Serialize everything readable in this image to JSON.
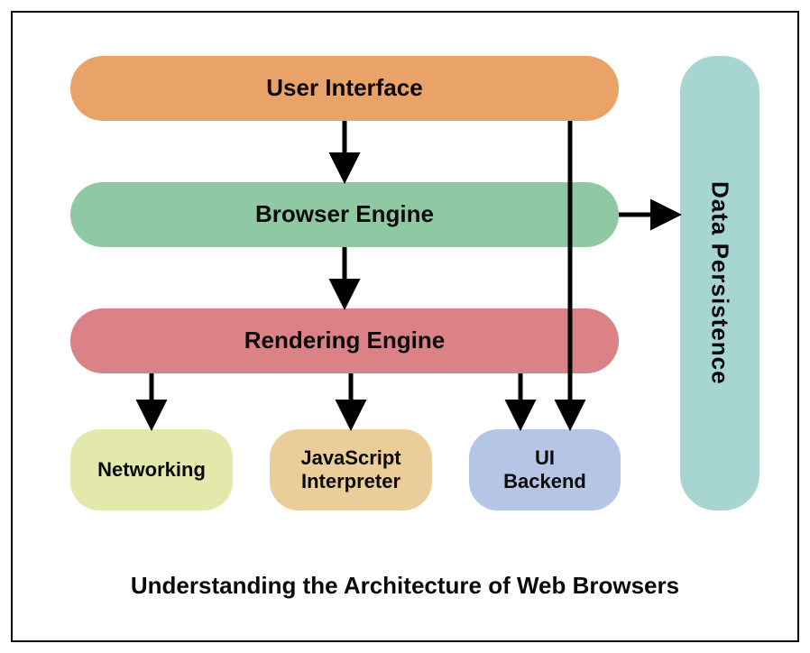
{
  "diagram": {
    "title": "Understanding the Architecture of Web Browsers",
    "boxes": {
      "user_interface": {
        "label": "User Interface",
        "color": "#e9a268"
      },
      "browser_engine": {
        "label": "Browser Engine",
        "color": "#8fc9a3"
      },
      "rendering_engine": {
        "label": "Rendering Engine",
        "color": "#da8286"
      },
      "networking": {
        "label": "Networking",
        "color": "#e2e9ab"
      },
      "js_interpreter": {
        "label": "JavaScript\nInterpreter",
        "color": "#ebcd99"
      },
      "ui_backend": {
        "label": "UI\nBackend",
        "color": "#b4c5e6"
      },
      "data_persistence": {
        "label": "Data Persistence",
        "color": "#a7d6d2"
      }
    },
    "edges": [
      {
        "from": "user_interface",
        "to": "browser_engine"
      },
      {
        "from": "browser_engine",
        "to": "rendering_engine"
      },
      {
        "from": "rendering_engine",
        "to": "networking"
      },
      {
        "from": "rendering_engine",
        "to": "js_interpreter"
      },
      {
        "from": "rendering_engine",
        "to": "ui_backend"
      },
      {
        "from": "user_interface",
        "to": "ui_backend"
      },
      {
        "from": "browser_engine",
        "to": "data_persistence"
      }
    ]
  }
}
